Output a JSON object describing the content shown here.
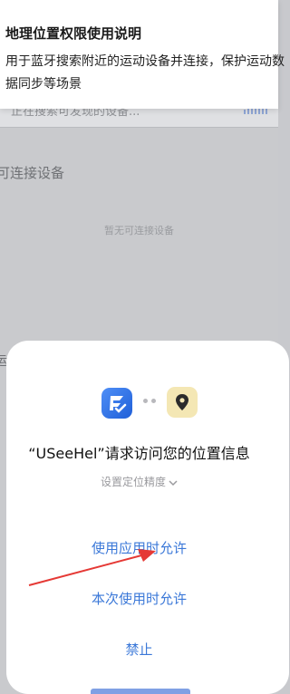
{
  "banner": {
    "title": "地理位置权限使用说明",
    "description": "用于蓝牙搜索附近的运动设备并连接，保护运动数据同步等场景"
  },
  "background": {
    "scanning_text": "正在搜索可发现的设备...",
    "section_label": "可连接设备",
    "empty_text": "暂无可连接设备",
    "side_char": "运"
  },
  "dialog": {
    "app_icon": "usee-app-icon",
    "location_icon": "location-pin-icon",
    "title": "“USeeHel”请求访问您的位置信息",
    "precision_label": "设置定位精度",
    "options": {
      "allow_while_using": "使用应用时允许",
      "allow_once": "本次使用时允许",
      "deny": "禁止"
    }
  },
  "colors": {
    "accent": "#3b78d8",
    "annotation_arrow": "#e53935"
  }
}
